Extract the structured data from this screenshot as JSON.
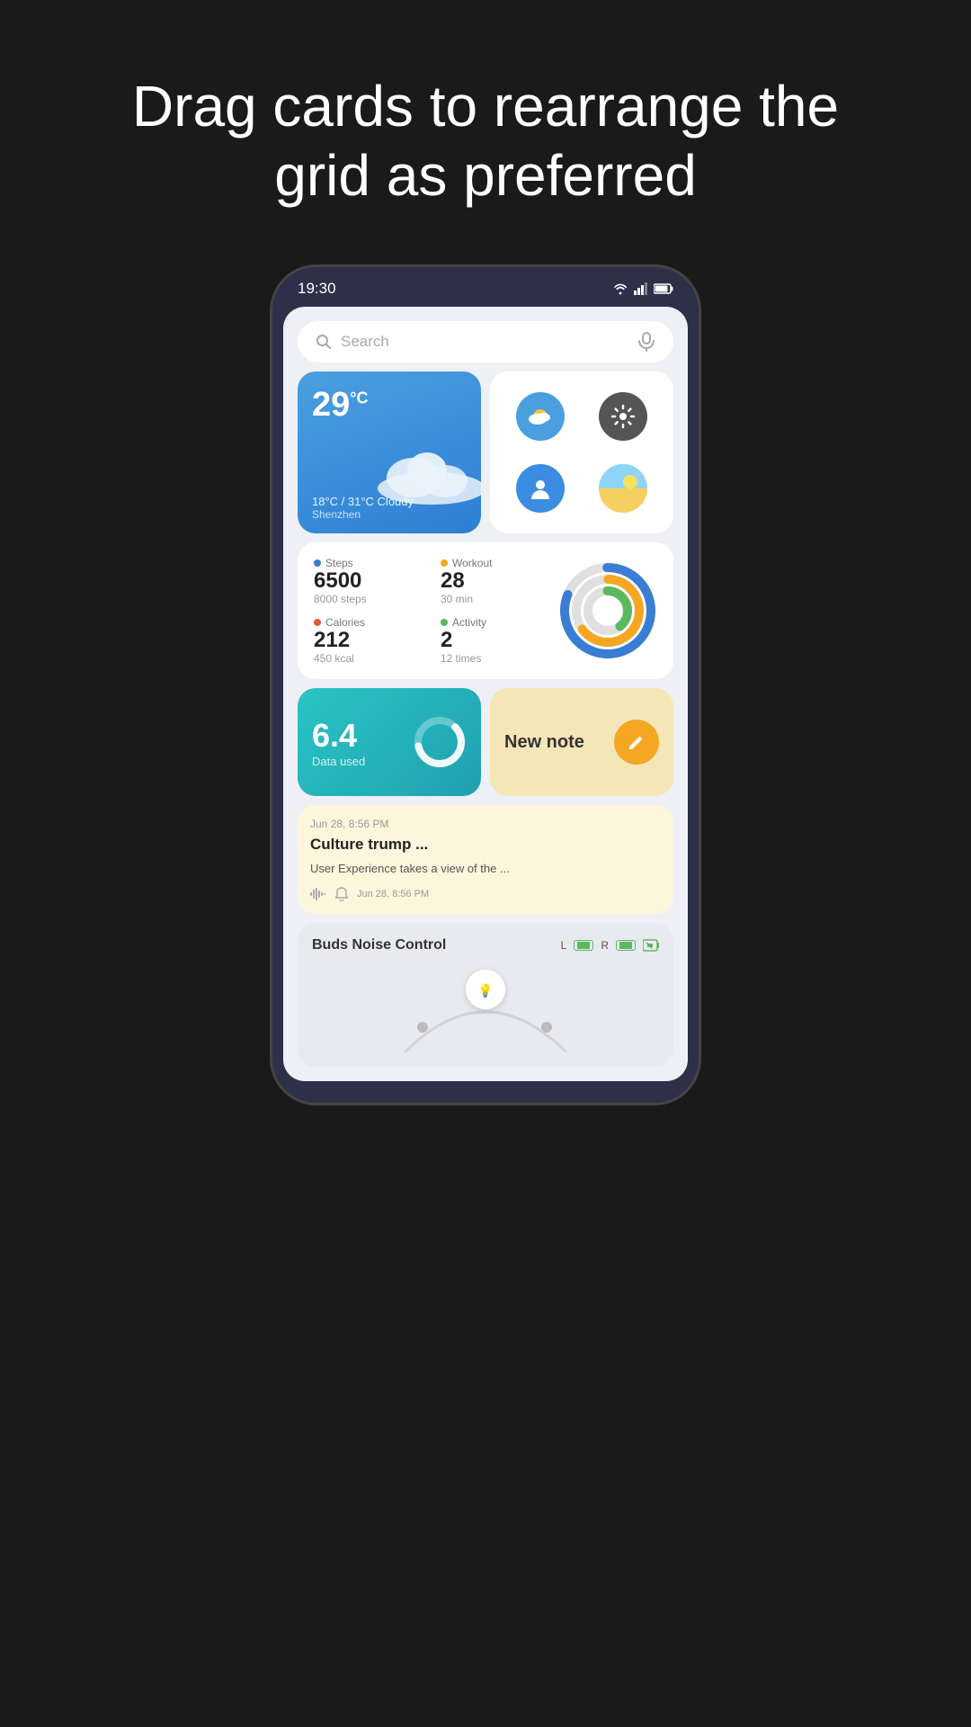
{
  "headline": "Drag cards to rearrange the grid as preferred",
  "phone": {
    "statusBar": {
      "time": "19:30"
    },
    "searchBar": {
      "placeholder": "Search"
    },
    "weatherCard": {
      "temp": "29",
      "unit": "°C",
      "range": "18°C / 31°C  Cloudy",
      "city": "Shenzhen"
    },
    "appGrid": {
      "apps": [
        {
          "name": "Weather",
          "icon": "☁️",
          "color": "#4a9fe0"
        },
        {
          "name": "Settings",
          "icon": "⚙️",
          "color": "#555"
        },
        {
          "name": "User",
          "icon": "👤",
          "color": "#3a8de0"
        },
        {
          "name": "Scenery",
          "icon": "🌅",
          "color": "#60b8f5"
        }
      ]
    },
    "fitnessCard": {
      "steps": {
        "label": "Steps",
        "value": "6500",
        "sub": "8000 steps",
        "dotClass": "dot-blue"
      },
      "workout": {
        "label": "Workout",
        "value": "28",
        "sub": "30 min",
        "dotClass": "dot-orange"
      },
      "calories": {
        "label": "Calories",
        "value": "212",
        "sub": "450 kcal",
        "dotClass": "dot-red"
      },
      "activity": {
        "label": "Activity",
        "value": "2",
        "sub": "12 times",
        "dotClass": "dot-green"
      }
    },
    "dataCard": {
      "value": "6.4",
      "label": "Data used"
    },
    "noteCard": {
      "label": "New note",
      "btnIcon": "✏️"
    },
    "newsCard": {
      "date": "Jun 28, 8:56 PM",
      "title": "Culture trump ...",
      "excerpt": "User Experience takes a view of the ...",
      "footerTime": "Jun 28, 8:56 PM"
    },
    "budsCard": {
      "title": "Buds Noise Control",
      "leftLabel": "L",
      "rightLabel": "R"
    }
  }
}
